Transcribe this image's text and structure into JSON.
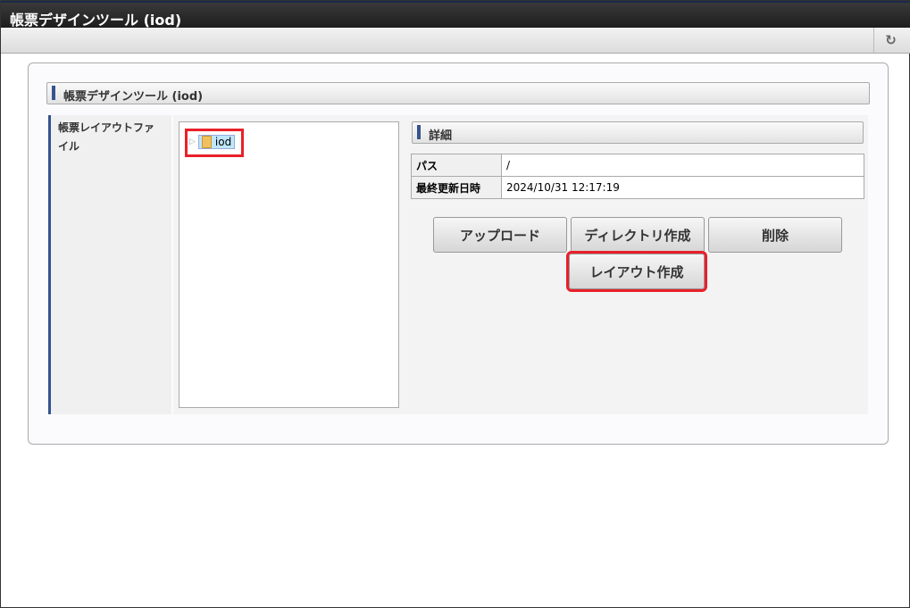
{
  "window": {
    "title": "帳票デザインツール (iod)"
  },
  "toolbar": {
    "refresh_icon": "refresh-icon"
  },
  "section": {
    "title": "帳票デザインツール (iod)",
    "label": "帳票レイアウトファイル"
  },
  "tree": {
    "nodes": [
      {
        "label": "iod"
      }
    ]
  },
  "details": {
    "title": "詳細",
    "rows": [
      {
        "key": "パス",
        "value": "/"
      },
      {
        "key": "最終更新日時",
        "value": "2024/10/31 12:17:19"
      }
    ]
  },
  "buttons": {
    "upload": "アップロード",
    "mkdir": "ディレクトリ作成",
    "delete": "削除",
    "create_layout": "レイアウト作成"
  }
}
